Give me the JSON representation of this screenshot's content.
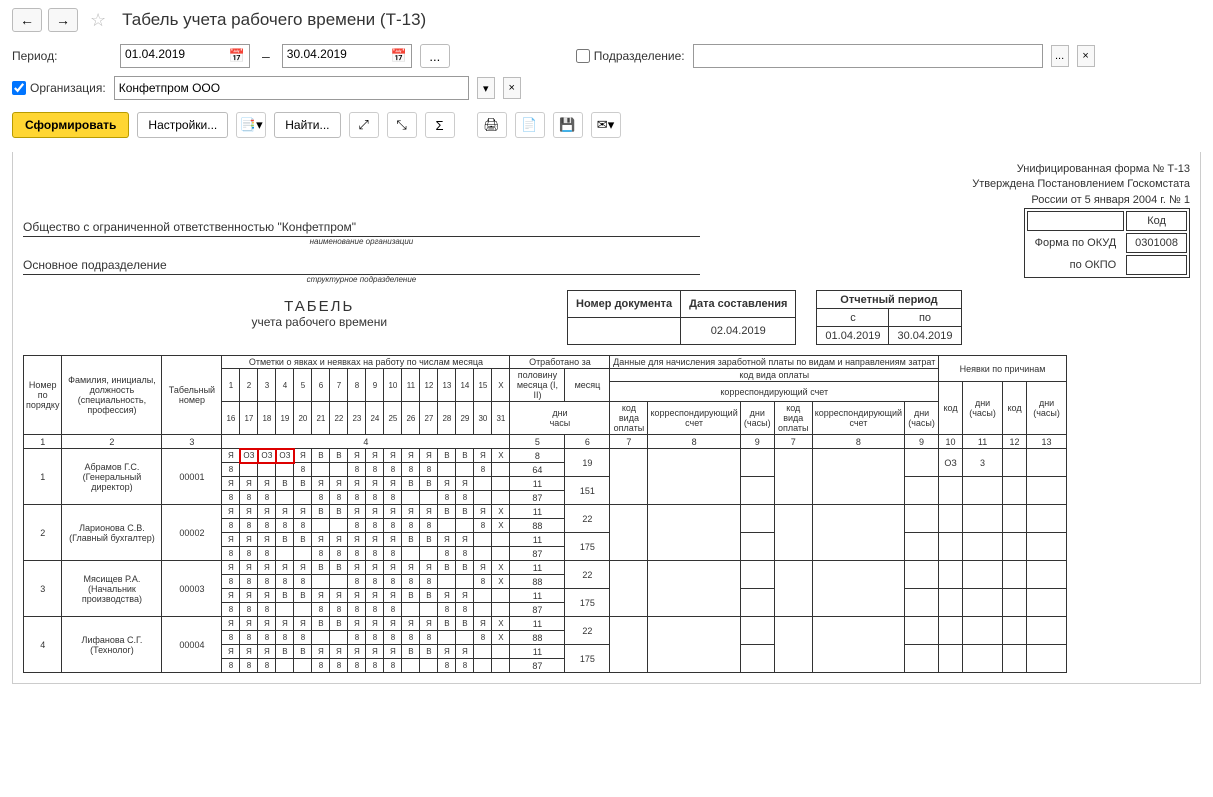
{
  "header": {
    "title": "Табель учета рабочего времени (Т-13)"
  },
  "filters": {
    "period_label": "Период:",
    "date_from": "01.04.2019",
    "date_to": "30.04.2019",
    "dash": "–",
    "dots": "...",
    "department_label": "Подразделение:",
    "department_value": "",
    "org_label": "Организация:",
    "org_value": "Конфетпром ООО"
  },
  "buttons": {
    "form": "Сформировать",
    "settings": "Настройки...",
    "find": "Найти..."
  },
  "report_meta": {
    "form_line1": "Унифицированная форма № Т-13",
    "form_line2": "Утверждена Постановлением Госкомстата",
    "form_line3": "России от 5 января 2004 г. № 1",
    "code_label": "Код",
    "okud_label": "Форма по ОКУД",
    "okud": "0301008",
    "okpo_label": "по ОКПО",
    "okpo": "",
    "org_full": "Общество с ограниченной ответственностью \"Конфетпром\"",
    "org_sub": "наименование организации",
    "dept_full": "Основное подразделение",
    "dept_sub": "структурное подразделение",
    "title": "ТАБЕЛЬ",
    "subtitle": "учета  рабочего времени",
    "doc_num_label": "Номер документа",
    "doc_num": "",
    "doc_date_label": "Дата составления",
    "doc_date": "02.04.2019",
    "period_label": "Отчетный период",
    "period_from_label": "с",
    "period_to_label": "по",
    "period_from": "01.04.2019",
    "period_to": "30.04.2019"
  },
  "table_headers": {
    "num": "Номер по порядку",
    "fio": "Фамилия, инициалы, должность (специальность, профессия)",
    "tab": "Табельный номер",
    "marks": "Отметки о явках и неявках на работу по числам месяца",
    "days_top": [
      "1",
      "2",
      "3",
      "4",
      "5",
      "6",
      "7",
      "8",
      "9",
      "10",
      "11",
      "12",
      "13",
      "14",
      "15",
      "X"
    ],
    "days_bot": [
      "16",
      "17",
      "18",
      "19",
      "20",
      "21",
      "22",
      "23",
      "24",
      "25",
      "26",
      "27",
      "28",
      "29",
      "30",
      "31"
    ],
    "worked": "Отработано за",
    "half": "половину месяца (I, II)",
    "month": "месяц",
    "days": "дни",
    "hours": "часы",
    "pay": "Данные для начисления заработной платы по видам и направлениям затрат",
    "pay_code": "код вида оплаты",
    "corr": "корреспондирующий счет",
    "pay_code_s": "код вида оплаты",
    "corr_s": "корреспондирующий счет",
    "dh": "дни (часы)",
    "absent": "Неявки по причинам",
    "code": "код",
    "col_nums": [
      "1",
      "2",
      "3",
      "4",
      "5",
      "6",
      "7",
      "8",
      "9",
      "7",
      "8",
      "9",
      "10",
      "11",
      "12",
      "13"
    ]
  },
  "employees": [
    {
      "num": "1",
      "name": "Абрамов Г.С. (Генеральный директор)",
      "tab": "00001",
      "r1": [
        "Я",
        "ОЗ",
        "ОЗ",
        "ОЗ",
        "Я",
        "В",
        "В",
        "Я",
        "Я",
        "Я",
        "Я",
        "Я",
        "В",
        "В",
        "Я",
        "X"
      ],
      "r2": [
        "8",
        "",
        "",
        "",
        "8",
        "",
        "",
        "8",
        "8",
        "8",
        "8",
        "8",
        "",
        "",
        "8",
        ""
      ],
      "r3": [
        "Я",
        "Я",
        "Я",
        "В",
        "В",
        "Я",
        "Я",
        "Я",
        "Я",
        "Я",
        "В",
        "В",
        "Я",
        "Я",
        "",
        " "
      ],
      "r4": [
        "8",
        "8",
        "8",
        "",
        "",
        "8",
        "8",
        "8",
        "8",
        "8",
        "",
        "",
        "8",
        "8",
        "",
        " "
      ],
      "half1": "8",
      "half1h": "64",
      "half2": "11",
      "half2h": "87",
      "md": "19",
      "mh": "151",
      "abs_code": "ОЗ",
      "abs_days": "3"
    },
    {
      "num": "2",
      "name": "Ларионова С.В. (Главный бухгалтер)",
      "tab": "00002",
      "r1": [
        "Я",
        "Я",
        "Я",
        "Я",
        "Я",
        "В",
        "В",
        "Я",
        "Я",
        "Я",
        "Я",
        "Я",
        "В",
        "В",
        "Я",
        "X"
      ],
      "r2": [
        "8",
        "8",
        "8",
        "8",
        "8",
        "",
        "",
        "8",
        "8",
        "8",
        "8",
        "8",
        "",
        "",
        "8",
        "X"
      ],
      "r3": [
        "Я",
        "Я",
        "Я",
        "В",
        "В",
        "Я",
        "Я",
        "Я",
        "Я",
        "Я",
        "В",
        "В",
        "Я",
        "Я",
        "",
        " "
      ],
      "r4": [
        "8",
        "8",
        "8",
        "",
        "",
        "8",
        "8",
        "8",
        "8",
        "8",
        "",
        "",
        "8",
        "8",
        "",
        " "
      ],
      "half1": "11",
      "half1h": "88",
      "half2": "11",
      "half2h": "87",
      "md": "22",
      "mh": "175",
      "abs_code": "",
      "abs_days": ""
    },
    {
      "num": "3",
      "name": "Мясищев Р.А. (Начальник производства)",
      "tab": "00003",
      "r1": [
        "Я",
        "Я",
        "Я",
        "Я",
        "Я",
        "В",
        "В",
        "Я",
        "Я",
        "Я",
        "Я",
        "Я",
        "В",
        "В",
        "Я",
        "X"
      ],
      "r2": [
        "8",
        "8",
        "8",
        "8",
        "8",
        "",
        "",
        "8",
        "8",
        "8",
        "8",
        "8",
        "",
        "",
        "8",
        "X"
      ],
      "r3": [
        "Я",
        "Я",
        "Я",
        "В",
        "В",
        "Я",
        "Я",
        "Я",
        "Я",
        "Я",
        "В",
        "В",
        "Я",
        "Я",
        "",
        " "
      ],
      "r4": [
        "8",
        "8",
        "8",
        "",
        "",
        "8",
        "8",
        "8",
        "8",
        "8",
        "",
        "",
        "8",
        "8",
        "",
        " "
      ],
      "half1": "11",
      "half1h": "88",
      "half2": "11",
      "half2h": "87",
      "md": "22",
      "mh": "175",
      "abs_code": "",
      "abs_days": ""
    },
    {
      "num": "4",
      "name": "Лифанова С.Г. (Технолог)",
      "tab": "00004",
      "r1": [
        "Я",
        "Я",
        "Я",
        "Я",
        "Я",
        "В",
        "В",
        "Я",
        "Я",
        "Я",
        "Я",
        "Я",
        "В",
        "В",
        "Я",
        "X"
      ],
      "r2": [
        "8",
        "8",
        "8",
        "8",
        "8",
        "",
        "",
        "8",
        "8",
        "8",
        "8",
        "8",
        "",
        "",
        "8",
        "X"
      ],
      "r3": [
        "Я",
        "Я",
        "Я",
        "В",
        "В",
        "Я",
        "Я",
        "Я",
        "Я",
        "Я",
        "В",
        "В",
        "Я",
        "Я",
        "",
        " "
      ],
      "r4": [
        "8",
        "8",
        "8",
        "",
        "",
        "8",
        "8",
        "8",
        "8",
        "8",
        "",
        "",
        "8",
        "8",
        "",
        " "
      ],
      "half1": "11",
      "half1h": "88",
      "half2": "11",
      "half2h": "87",
      "md": "22",
      "mh": "175",
      "abs_code": "",
      "abs_days": ""
    }
  ]
}
